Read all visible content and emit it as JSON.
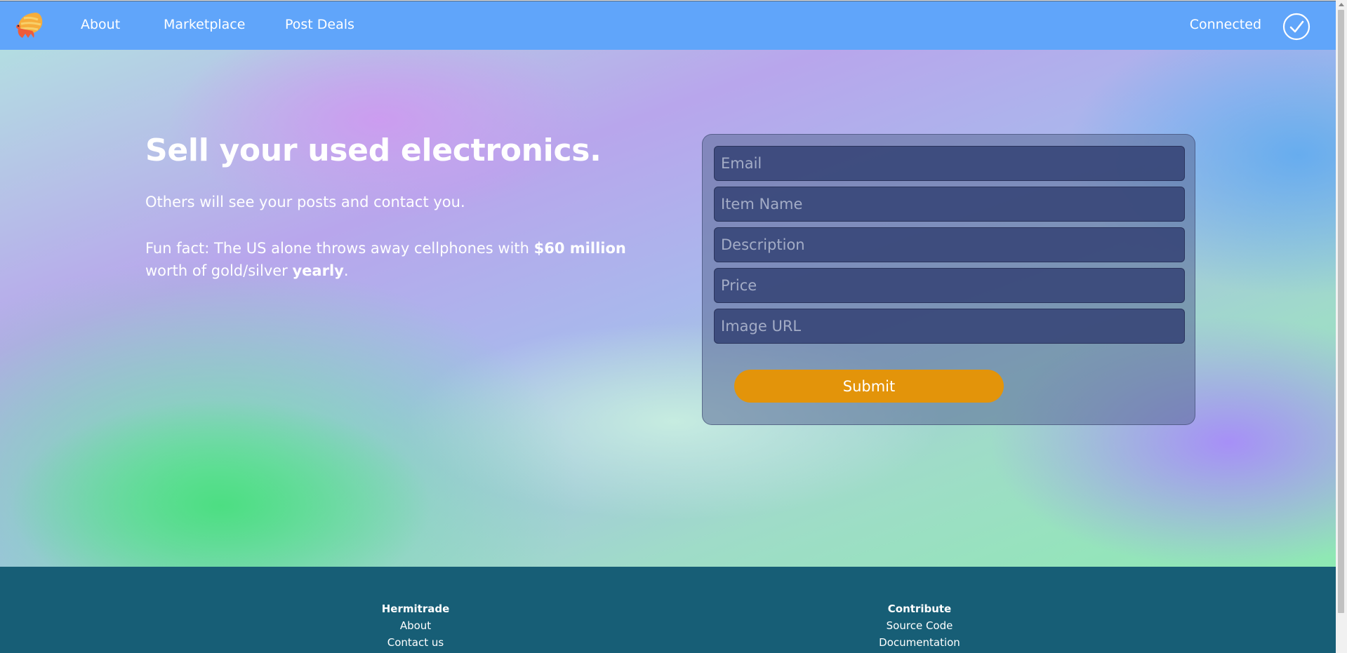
{
  "nav": {
    "links": [
      "About",
      "Marketplace",
      "Post Deals"
    ],
    "status": "Connected"
  },
  "hero": {
    "title": "Sell your used electronics.",
    "subtitle": "Others will see your posts and contact you.",
    "fact_prefix": "Fun fact: The US alone throws away cellphones with ",
    "fact_bold1": "$60 million",
    "fact_mid": " worth of gold/silver ",
    "fact_bold2": "yearly",
    "fact_suffix": "."
  },
  "form": {
    "email_placeholder": "Email",
    "item_placeholder": "Item Name",
    "description_placeholder": "Description",
    "price_placeholder": "Price",
    "image_placeholder": "Image URL",
    "submit_label": "Submit"
  },
  "footer": {
    "col1": {
      "title": "Hermitrade",
      "links": [
        "About",
        "Contact us"
      ]
    },
    "col2": {
      "title": "Contribute",
      "links": [
        "Source Code",
        "Documentation"
      ]
    }
  },
  "colors": {
    "nav": "#60a5fa",
    "submit": "#e3940a",
    "footer": "#175e76"
  }
}
